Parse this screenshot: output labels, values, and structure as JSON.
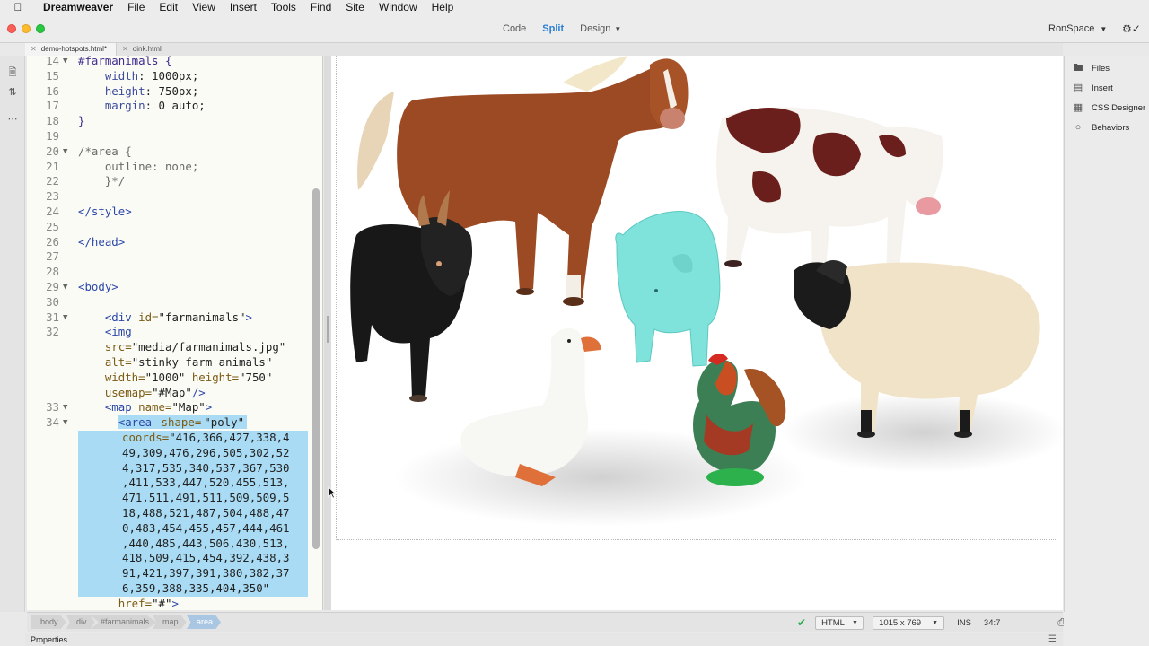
{
  "menubar": {
    "app": "Dreamweaver",
    "items": [
      "File",
      "Edit",
      "View",
      "Insert",
      "Tools",
      "Find",
      "Site",
      "Window",
      "Help"
    ]
  },
  "toolbar": {
    "view_modes": [
      "Code",
      "Split",
      "Design"
    ],
    "active_mode": "Split",
    "workspace": "RonSpace"
  },
  "tabs": [
    {
      "label": "demo-hotspots.html*",
      "active": true
    },
    {
      "label": "oink.html",
      "active": false
    }
  ],
  "code_lines": [
    {
      "n": "14",
      "fold": "▼",
      "sel": "none",
      "tokens": [
        {
          "t": "#farmanimals {",
          "c": "sel"
        }
      ]
    },
    {
      "n": "15",
      "fold": "",
      "sel": "none",
      "tokens": [
        {
          "t": "    width",
          "c": "prop"
        },
        {
          "t": ": 1000px;",
          "c": "val"
        }
      ]
    },
    {
      "n": "16",
      "fold": "",
      "sel": "none",
      "tokens": [
        {
          "t": "    height",
          "c": "prop"
        },
        {
          "t": ": 750px;",
          "c": "val"
        }
      ]
    },
    {
      "n": "17",
      "fold": "",
      "sel": "none",
      "tokens": [
        {
          "t": "    margin",
          "c": "prop"
        },
        {
          "t": ": 0 auto;",
          "c": "val"
        }
      ]
    },
    {
      "n": "18",
      "fold": "",
      "sel": "none",
      "tokens": [
        {
          "t": "}",
          "c": "sel"
        }
      ]
    },
    {
      "n": "19",
      "fold": "",
      "sel": "none",
      "tokens": []
    },
    {
      "n": "20",
      "fold": "▼",
      "sel": "none",
      "tokens": [
        {
          "t": "/*area {",
          "c": "com"
        }
      ]
    },
    {
      "n": "21",
      "fold": "",
      "sel": "none",
      "tokens": [
        {
          "t": "    outline: none;",
          "c": "com"
        }
      ]
    },
    {
      "n": "22",
      "fold": "",
      "sel": "none",
      "tokens": [
        {
          "t": "    }*/",
          "c": "com"
        }
      ]
    },
    {
      "n": "23",
      "fold": "",
      "sel": "none",
      "tokens": []
    },
    {
      "n": "24",
      "fold": "",
      "sel": "none",
      "tokens": [
        {
          "t": "</style>",
          "c": "tag"
        }
      ]
    },
    {
      "n": "25",
      "fold": "",
      "sel": "none",
      "tokens": []
    },
    {
      "n": "26",
      "fold": "",
      "sel": "none",
      "tokens": [
        {
          "t": "</head>",
          "c": "tag"
        }
      ]
    },
    {
      "n": "27",
      "fold": "",
      "sel": "none",
      "tokens": []
    },
    {
      "n": "28",
      "fold": "",
      "sel": "none",
      "tokens": []
    },
    {
      "n": "29",
      "fold": "▼",
      "sel": "none",
      "tokens": [
        {
          "t": "<body>",
          "c": "tag"
        }
      ]
    },
    {
      "n": "30",
      "fold": "",
      "sel": "none",
      "tokens": []
    },
    {
      "n": "31",
      "fold": "▼",
      "sel": "none",
      "tokens": [
        {
          "t": "    <div ",
          "c": "tag"
        },
        {
          "t": "id=",
          "c": "attr"
        },
        {
          "t": "\"farmanimals\"",
          "c": "str"
        },
        {
          "t": ">",
          "c": "tag"
        }
      ]
    },
    {
      "n": "32",
      "fold": "",
      "sel": "none",
      "tokens": [
        {
          "t": "    <img",
          "c": "tag"
        }
      ]
    },
    {
      "n": "",
      "fold": "",
      "sel": "none",
      "tokens": [
        {
          "t": "    src=",
          "c": "attr"
        },
        {
          "t": "\"media/farmanimals.jpg\"",
          "c": "str"
        }
      ]
    },
    {
      "n": "",
      "fold": "",
      "sel": "none",
      "tokens": [
        {
          "t": "    alt=",
          "c": "attr"
        },
        {
          "t": "\"stinky farm animals\"",
          "c": "str"
        }
      ]
    },
    {
      "n": "",
      "fold": "",
      "sel": "none",
      "tokens": [
        {
          "t": "    width=",
          "c": "attr"
        },
        {
          "t": "\"1000\" ",
          "c": "str"
        },
        {
          "t": "height=",
          "c": "attr"
        },
        {
          "t": "\"750\"",
          "c": "str"
        }
      ]
    },
    {
      "n": "",
      "fold": "",
      "sel": "none",
      "tokens": [
        {
          "t": "    usemap=",
          "c": "attr"
        },
        {
          "t": "\"#Map\"",
          "c": "str"
        },
        {
          "t": "/>",
          "c": "tag"
        }
      ]
    },
    {
      "n": "33",
      "fold": "▼",
      "sel": "none",
      "tokens": [
        {
          "t": "    <map ",
          "c": "tag"
        },
        {
          "t": "name=",
          "c": "attr"
        },
        {
          "t": "\"Map\"",
          "c": "str"
        },
        {
          "t": ">",
          "c": "tag"
        }
      ]
    },
    {
      "n": "34",
      "fold": "▼",
      "sel": "part",
      "tokens": [
        {
          "t": "      ",
          "c": "val"
        },
        {
          "t": "<area ",
          "c": "tag",
          "hl": true
        },
        {
          "t": "shape=",
          "c": "attr",
          "hl": true
        },
        {
          "t": "\"poly\"",
          "c": "str",
          "hl": true
        }
      ]
    },
    {
      "n": "",
      "fold": "",
      "sel": "full",
      "tokens": [
        {
          "t": "coords=",
          "c": "attr"
        },
        {
          "t": "\"416,366,427,338,4",
          "c": "str"
        }
      ]
    },
    {
      "n": "",
      "fold": "",
      "sel": "full",
      "tokens": [
        {
          "t": "49,309,476,296,505,302,52",
          "c": "str"
        }
      ]
    },
    {
      "n": "",
      "fold": "",
      "sel": "full",
      "tokens": [
        {
          "t": "4,317,535,340,537,367,530",
          "c": "str"
        }
      ]
    },
    {
      "n": "",
      "fold": "",
      "sel": "full",
      "tokens": [
        {
          "t": ",411,533,447,520,455,513,",
          "c": "str"
        }
      ]
    },
    {
      "n": "",
      "fold": "",
      "sel": "full",
      "tokens": [
        {
          "t": "471,511,491,511,509,509,5",
          "c": "str"
        }
      ]
    },
    {
      "n": "",
      "fold": "",
      "sel": "full",
      "tokens": [
        {
          "t": "18,488,521,487,504,488,47",
          "c": "str"
        }
      ]
    },
    {
      "n": "",
      "fold": "",
      "sel": "full",
      "tokens": [
        {
          "t": "0,483,454,455,457,444,461",
          "c": "str"
        }
      ]
    },
    {
      "n": "",
      "fold": "",
      "sel": "full",
      "tokens": [
        {
          "t": ",440,485,443,506,430,513,",
          "c": "str"
        }
      ]
    },
    {
      "n": "",
      "fold": "",
      "sel": "full",
      "tokens": [
        {
          "t": "418,509,415,454,392,438,3",
          "c": "str"
        }
      ]
    },
    {
      "n": "",
      "fold": "",
      "sel": "full",
      "tokens": [
        {
          "t": "91,421,397,391,380,382,37",
          "c": "str"
        }
      ]
    },
    {
      "n": "",
      "fold": "",
      "sel": "full",
      "tokens": [
        {
          "t": "6,359,388,335,404,350\"",
          "c": "str"
        }
      ]
    },
    {
      "n": "",
      "fold": "",
      "sel": "none",
      "tokens": [
        {
          "t": "      href=",
          "c": "attr"
        },
        {
          "t": "\"#\"",
          "c": "str"
        },
        {
          "t": ">",
          "c": "tag"
        }
      ]
    }
  ],
  "right_panel": {
    "items": [
      {
        "label": "Files",
        "icon": "folder-icon"
      },
      {
        "label": "Insert",
        "icon": "insert-icon"
      },
      {
        "label": "CSS Designer",
        "icon": "css-designer-icon"
      },
      {
        "label": "Behaviors",
        "icon": "behaviors-icon"
      }
    ]
  },
  "tag_selector": [
    "body",
    "div",
    "#farmanimals",
    "map",
    "area"
  ],
  "tag_selector_active": "area",
  "status": {
    "doc_type": "HTML",
    "window_size": "1015 x 769",
    "insert_mode": "INS",
    "cursor_pos": "34:7"
  },
  "properties_label": "Properties",
  "colors": {
    "accent": "#2a7fd4",
    "selection": "#a9dcf4",
    "pig_hotspot": "#7fe3dc"
  }
}
